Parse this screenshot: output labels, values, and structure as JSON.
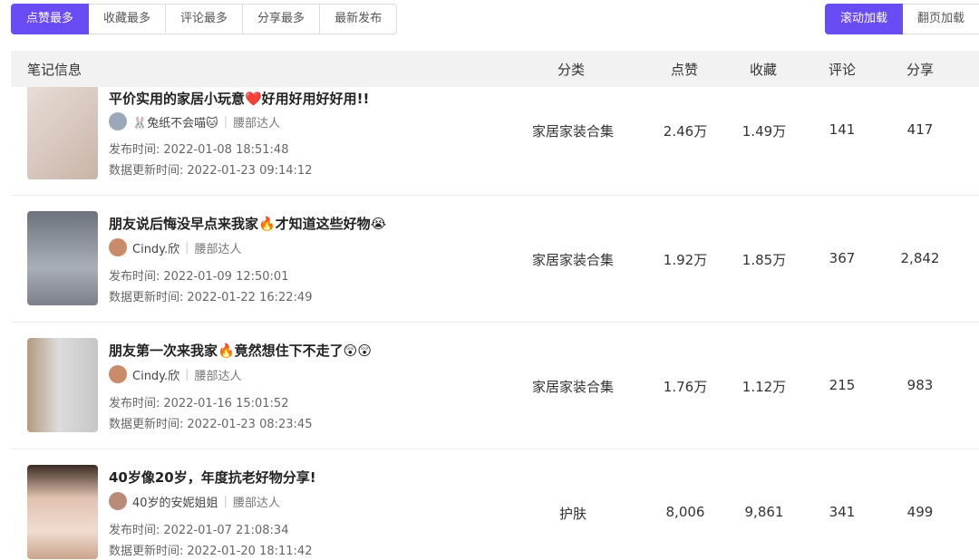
{
  "sort_tabs": [
    "点赞最多",
    "收藏最多",
    "评论最多",
    "分享最多",
    "最新发布"
  ],
  "load_modes": [
    "滚动加载",
    "翻页加载"
  ],
  "columns": {
    "info": "笔记信息",
    "category": "分类",
    "likes": "点赞",
    "favorites": "收藏",
    "comments": "评论",
    "shares": "分享"
  },
  "labels": {
    "published": "发布时间:",
    "updated": "数据更新时间:"
  },
  "notes": [
    {
      "title": "平价实用的家居小玩意❤️好用好用好好用!!",
      "author": "🐰兔纸不会喵🐱",
      "author_tag": "腰部达人",
      "published": "2022-01-08 18:51:48",
      "updated": "2022-01-23 09:14:12",
      "category": "家居家装合集",
      "likes": "2.46万",
      "favorites": "1.49万",
      "comments": "141",
      "shares": "417",
      "thumb_color": "#d8c7bd"
    },
    {
      "title": "朋友说后悔没早点来我家🔥才知道这些好物😭",
      "author": "Cindy.欣",
      "author_tag": "腰部达人",
      "published": "2022-01-09 12:50:01",
      "updated": "2022-01-22 16:22:49",
      "category": "家居家装合集",
      "likes": "1.92万",
      "favorites": "1.85万",
      "comments": "367",
      "shares": "2,842",
      "thumb_color": "#8a8f98"
    },
    {
      "title": "朋友第一次来我家🔥竟然想住下不走了😲😲",
      "author": "Cindy.欣",
      "author_tag": "腰部达人",
      "published": "2022-01-16 15:01:52",
      "updated": "2022-01-23 08:23:45",
      "category": "家居家装合集",
      "likes": "1.76万",
      "favorites": "1.12万",
      "comments": "215",
      "shares": "983",
      "thumb_color": "#b7b3ae"
    },
    {
      "title": "40岁像20岁，年度抗老好物分享!",
      "author": "40岁的安妮姐姐",
      "author_tag": "腰部达人",
      "published": "2022-01-07 21:08:34",
      "updated": "2022-01-20 18:11:42",
      "category": "护肤",
      "likes": "8,006",
      "favorites": "9,861",
      "comments": "341",
      "shares": "499",
      "thumb_color": "#d9b9a6"
    }
  ]
}
